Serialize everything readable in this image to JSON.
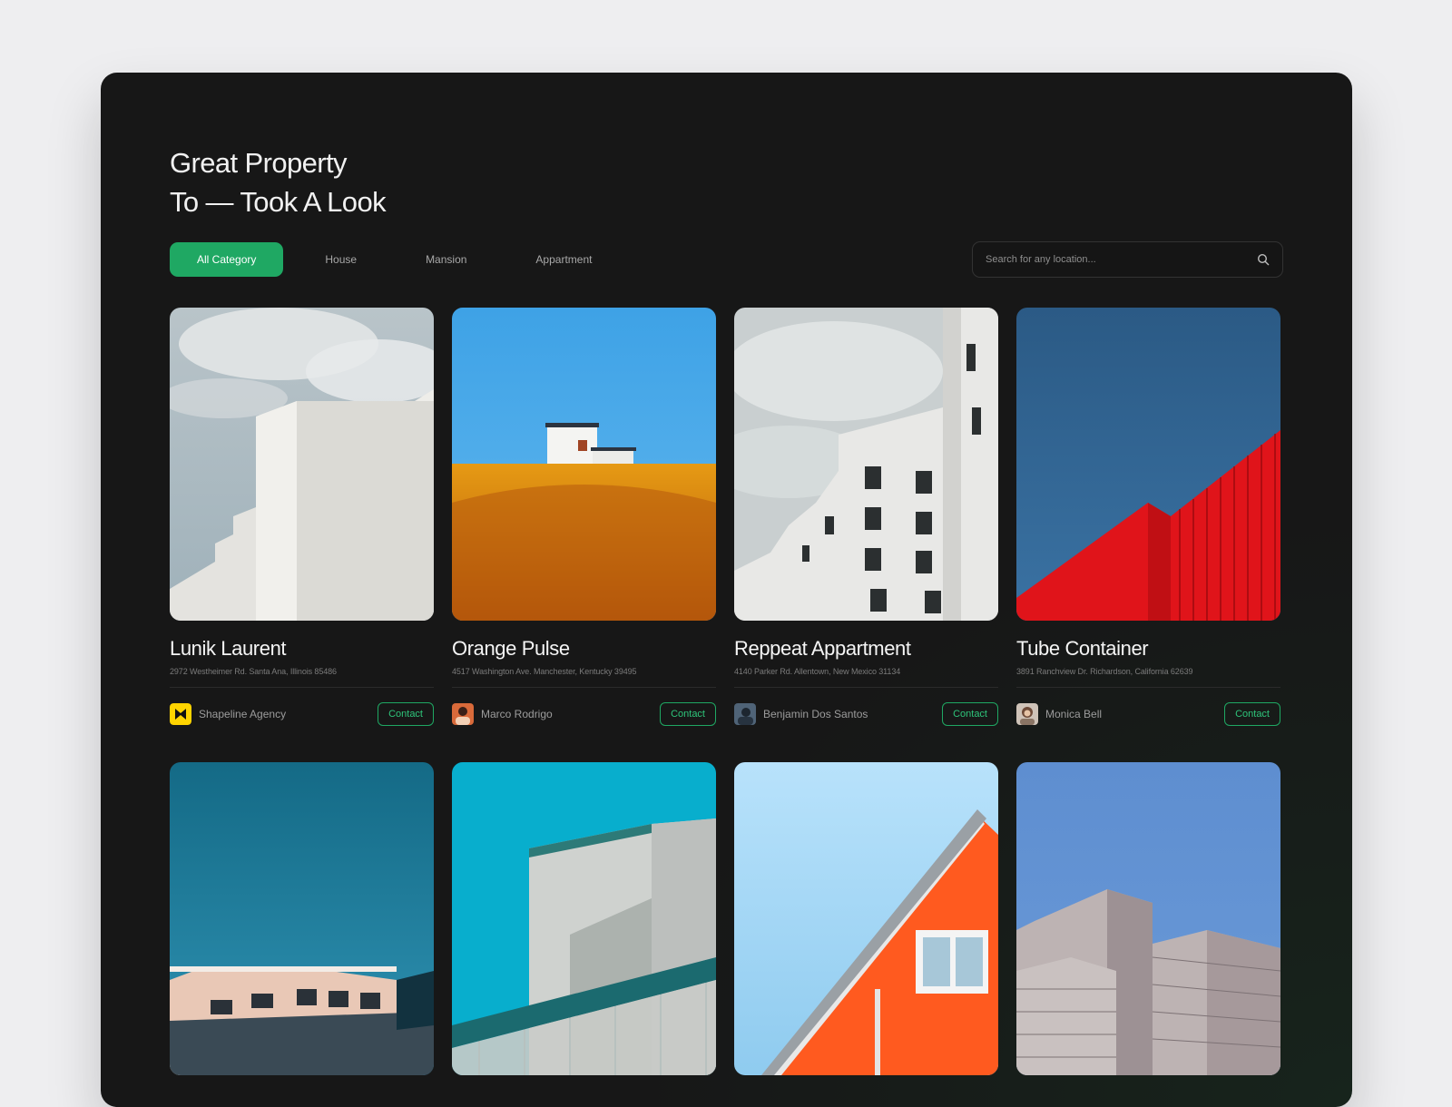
{
  "header": {
    "title_line1": "Great Property",
    "title_line2": "To — Took A Look"
  },
  "filters": {
    "tabs": [
      {
        "label": "All Category",
        "active": true
      },
      {
        "label": "House",
        "active": false
      },
      {
        "label": "Mansion",
        "active": false
      },
      {
        "label": "Appartment",
        "active": false
      }
    ]
  },
  "search": {
    "placeholder": "Search for any location...",
    "icon": "search-icon"
  },
  "listings": [
    {
      "name": "Lunik Laurent",
      "address": "2972 Westheimer Rd. Santa Ana, Illinois 85486",
      "agent": "Shapeline Agency",
      "avatar": "agency-logo",
      "contact_label": "Contact"
    },
    {
      "name": "Orange Pulse",
      "address": "4517 Washington Ave. Manchester, Kentucky 39495",
      "agent": "Marco Rodrigo",
      "avatar": "person-avatar",
      "contact_label": "Contact"
    },
    {
      "name": "Reppeat Appartment",
      "address": "4140 Parker Rd. Allentown, New Mexico 31134",
      "agent": "Benjamin Dos Santos",
      "avatar": "person-avatar",
      "contact_label": "Contact"
    },
    {
      "name": "Tube Container",
      "address": "3891 Ranchview Dr. Richardson, California 62639",
      "agent": "Monica Bell",
      "avatar": "person-avatar",
      "contact_label": "Contact"
    }
  ],
  "colors": {
    "accent": "#1fa863",
    "background": "#171717",
    "page": "#eeeef0"
  }
}
